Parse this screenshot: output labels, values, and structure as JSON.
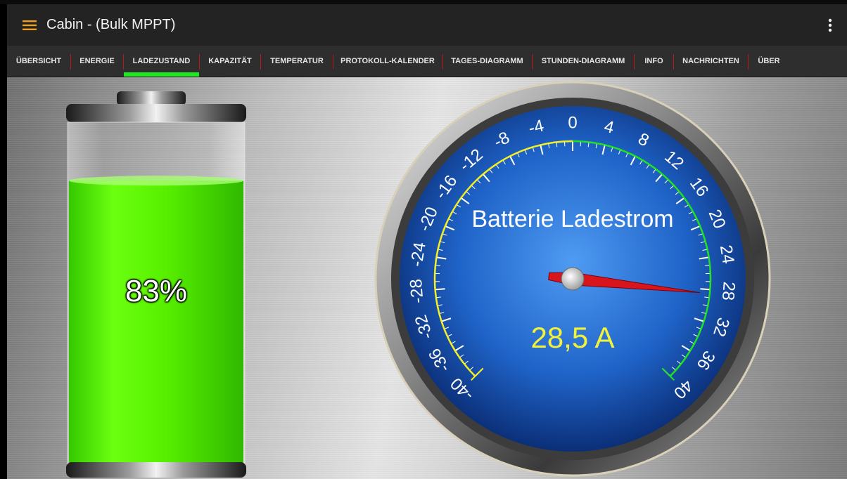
{
  "app": {
    "title": "Cabin - (Bulk MPPT)"
  },
  "icons": {
    "menu": "hamburger-icon",
    "overflow": "more-vert-icon"
  },
  "colors": {
    "menu_icon": "#f0a020",
    "tab_indicator": "#1ee81e",
    "tab_separator": "#c01818",
    "battery_fill": "#5ef400"
  },
  "tabs": [
    {
      "label": "ÜBERSICHT"
    },
    {
      "label": "ENERGIE"
    },
    {
      "label": "LADEZUSTAND",
      "selected": true
    },
    {
      "label": "KAPAZITÄT"
    },
    {
      "label": "TEMPERATUR"
    },
    {
      "label": "PROTOKOLL-KALENDER"
    },
    {
      "label": "TAGES-DIAGRAMM"
    },
    {
      "label": "STUNDEN-DIAGRAMM"
    },
    {
      "label": "INFO"
    },
    {
      "label": "NACHRICHTEN"
    },
    {
      "label": "ÜBER"
    }
  ],
  "battery": {
    "level_percent": 83,
    "label": "83%"
  },
  "gauge": {
    "title": "Batterie Ladestrom",
    "value": 28.5,
    "value_label": "28,5 A",
    "min": -40,
    "max": 40,
    "tick_labels": [
      "-40",
      "-36",
      "-32",
      "-28",
      "-24",
      "-20",
      "-16",
      "-12",
      "-8",
      "-4",
      "0",
      "4",
      "8",
      "12",
      "16",
      "20",
      "24",
      "28",
      "32",
      "36",
      "40"
    ]
  }
}
